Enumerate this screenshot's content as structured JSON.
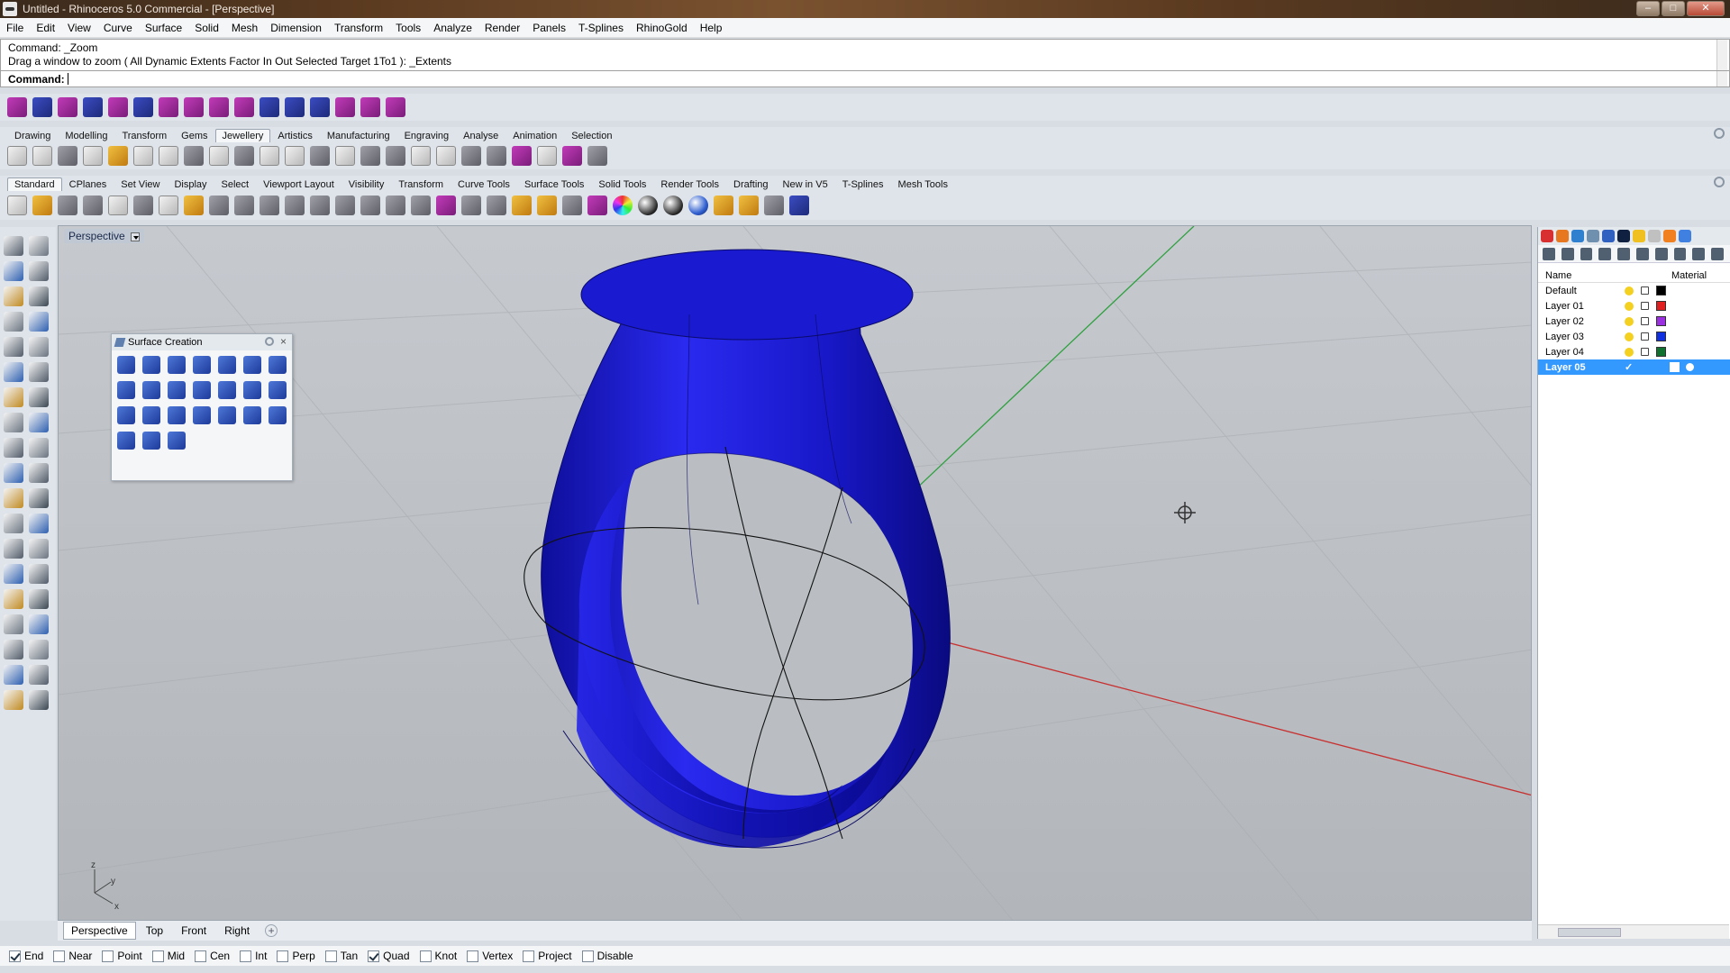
{
  "window": {
    "title": "Untitled - Rhinoceros 5.0 Commercial - [Perspective]",
    "minimize": "–",
    "maximize": "□",
    "close": "✕"
  },
  "menu": [
    "File",
    "Edit",
    "View",
    "Curve",
    "Surface",
    "Solid",
    "Mesh",
    "Dimension",
    "Transform",
    "Tools",
    "Analyze",
    "Render",
    "Panels",
    "T-Splines",
    "RhinoGold",
    "Help"
  ],
  "command": {
    "history_line1": "Command: _Zoom",
    "history_line2": "Drag a window to zoom ( All  Dynamic  Extents  Factor  In  Out  Selected  Target  1To1 ): _Extents",
    "prompt_label": "Command:"
  },
  "tab_row_1": {
    "tabs": [
      "Drawing",
      "Modelling",
      "Transform",
      "Gems",
      "Jewellery",
      "Artistics",
      "Manufacturing",
      "Engraving",
      "Analyse",
      "Animation",
      "Selection"
    ],
    "active": "Jewellery"
  },
  "tab_row_2": {
    "tabs": [
      "Standard",
      "CPlanes",
      "Set View",
      "Display",
      "Select",
      "Viewport Layout",
      "Visibility",
      "Transform",
      "Curve Tools",
      "Surface Tools",
      "Solid Tools",
      "Render Tools",
      "Drafting",
      "New in V5",
      "T-Splines",
      "Mesh Tools"
    ],
    "active": "Standard"
  },
  "viewport": {
    "title": "Perspective",
    "axis_x": "x",
    "axis_y": "y",
    "axis_z": "z"
  },
  "surface_panel": {
    "title": "Surface Creation"
  },
  "layers": {
    "col_name": "Name",
    "col_material": "Material",
    "rows": [
      {
        "name": "Default",
        "color": "#000000",
        "active": false
      },
      {
        "name": "Layer 01",
        "color": "#e02020",
        "active": false
      },
      {
        "name": "Layer 02",
        "color": "#9a30e0",
        "active": false
      },
      {
        "name": "Layer 03",
        "color": "#1030e0",
        "active": false
      },
      {
        "name": "Layer 04",
        "color": "#107030",
        "active": false
      },
      {
        "name": "Layer 05",
        "color": "#ffffff",
        "active": true,
        "check": "✓"
      }
    ]
  },
  "viewport_tabs": [
    "Perspective",
    "Top",
    "Front",
    "Right"
  ],
  "viewport_tab_add": "+",
  "osnap": [
    {
      "label": "End",
      "checked": true
    },
    {
      "label": "Near",
      "checked": false
    },
    {
      "label": "Point",
      "checked": false
    },
    {
      "label": "Mid",
      "checked": false
    },
    {
      "label": "Cen",
      "checked": false
    },
    {
      "label": "Int",
      "checked": false
    },
    {
      "label": "Perp",
      "checked": false
    },
    {
      "label": "Tan",
      "checked": false
    },
    {
      "label": "Quad",
      "checked": true
    },
    {
      "label": "Knot",
      "checked": false
    },
    {
      "label": "Vertex",
      "checked": false
    },
    {
      "label": "Project",
      "checked": false
    },
    {
      "label": "Disable",
      "checked": false
    }
  ],
  "colors": {
    "ring": "#1a1ad8",
    "x_axis": "#c83030",
    "y_axis": "#30a040",
    "selection": "#3399ff"
  }
}
